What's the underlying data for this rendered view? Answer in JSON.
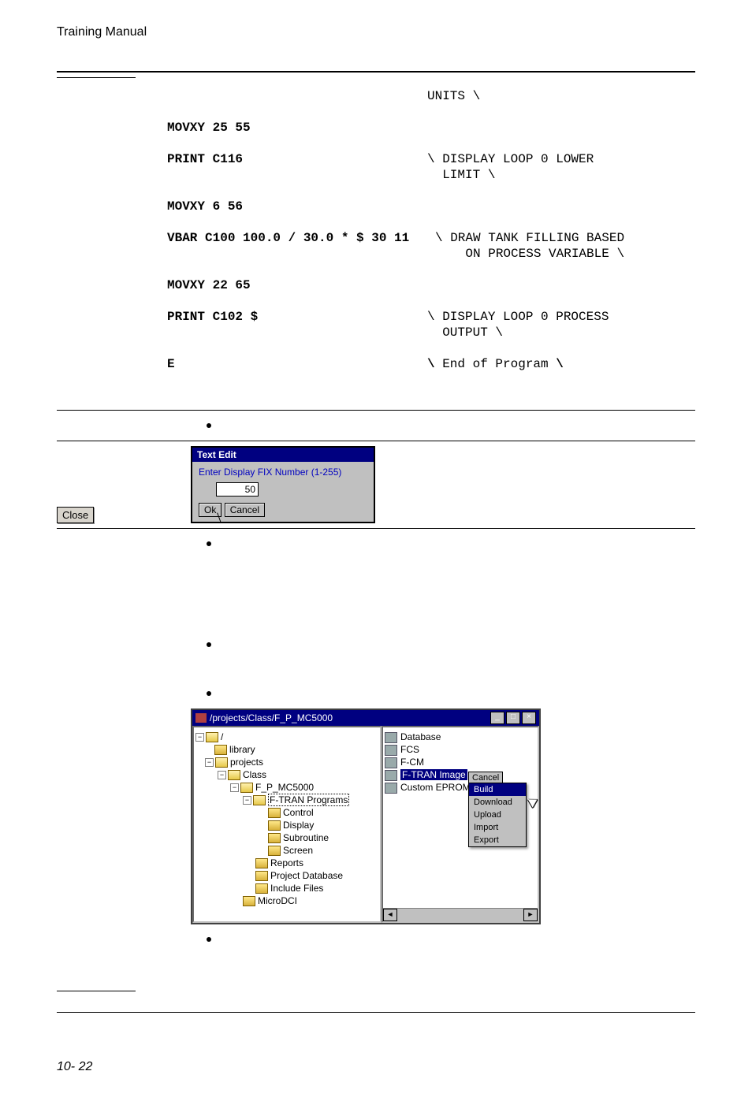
{
  "header": "Training Manual",
  "code": {
    "r0_cmt": "UNITS \\",
    "r1_cmd": "MOVXY 25 55",
    "r2_cmd": "PRINT C116",
    "r2_cmt": "\\ DISPLAY LOOP 0 LOWER\n  LIMIT \\",
    "r3_cmd": "MOVXY 6 56",
    "r4_cmd": "VBAR C100 100.0 / 30.0 * $ 30 11",
    "r4_cmt": "\\ DRAW TANK FILLING BASED\n    ON PROCESS VARIABLE \\",
    "r5_cmd": "MOVXY 22 65",
    "r6_cmd": "PRINT C102 $",
    "r6_cmt": "\\ DISPLAY LOOP 0 PROCESS\n  OUTPUT \\",
    "r7_cmd": "E",
    "r7_cmt_b": "\\ ",
    "r7_cmt_n": "End of Program ",
    "r7_cmt_b2": "\\"
  },
  "close_label": "Close",
  "text_edit": {
    "title": "Text Edit",
    "prompt": "Enter Display FIX Number (1-255)",
    "value": "50",
    "ok": "Ok",
    "cancel": "Cancel"
  },
  "project": {
    "title": "/projects/Class/F_P_MC5000",
    "tree": {
      "root": "/",
      "n_library": "library",
      "n_projects": "projects",
      "n_class": "Class",
      "n_fpmc": "F_P_MC5000",
      "n_ftran": "F-TRAN Programs",
      "n_control": "Control",
      "n_display": "Display",
      "n_subroutine": "Subroutine",
      "n_screen": "Screen",
      "n_reports": "Reports",
      "n_projdb": "Project Database",
      "n_include": "Include Files",
      "n_microdci": "MicroDCI"
    },
    "list": {
      "i_database": "Database",
      "i_fcs": "FCS",
      "i_fcm": "F-CM",
      "i_ftran_img": "F-TRAN Image",
      "i_custom": "Custom EPROM"
    },
    "popup_cancel": "Cancel",
    "popup": {
      "build": "Build",
      "download": "Download",
      "upload": "Upload",
      "import": "Import",
      "export": "Export"
    },
    "win_btns": {
      "min": "_",
      "max": "□",
      "close": "×"
    }
  },
  "footer": "10- 22"
}
